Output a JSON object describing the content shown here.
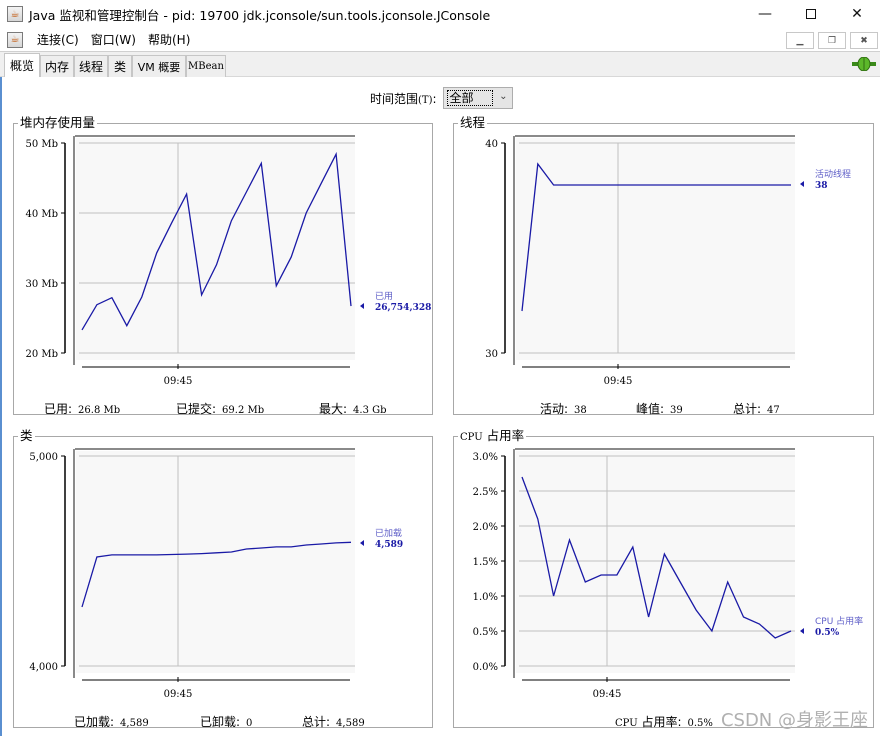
{
  "window": {
    "title": "Java 监视和管理控制台 - pid: 19700 jdk.jconsole/sun.tools.jconsole.JConsole",
    "controls": [
      "minimize",
      "maximize",
      "close"
    ]
  },
  "menubar": {
    "items": [
      {
        "label": "连接(C)"
      },
      {
        "label": "窗口(W)"
      },
      {
        "label": "帮助(H)"
      }
    ]
  },
  "tabs": [
    {
      "label": "概览",
      "active": true
    },
    {
      "label": "内存",
      "active": false
    },
    {
      "label": "线程",
      "active": false
    },
    {
      "label": "类",
      "active": false
    },
    {
      "label": "VM 概要",
      "active": false
    },
    {
      "label": "MBean",
      "active": false
    }
  ],
  "connection_icon": "plug-connected-icon",
  "time_range": {
    "label": "时间范围",
    "mnemonic": "(T)",
    "colon": ":",
    "selected": "全部"
  },
  "colors": {
    "series": "#1a1aa6",
    "grid": "#c0c0c0",
    "plot_bg": "#f8f8f8",
    "legend_label": "#6060c8"
  },
  "chart_data": [
    {
      "id": "heap",
      "type": "line",
      "title": "堆内存使用量",
      "ylabel": "Mb",
      "ylim": [
        20,
        50
      ],
      "yticks": [
        20,
        30,
        40,
        50
      ],
      "ytick_labels": [
        "20 Mb",
        "30 Mb",
        "40 Mb",
        "50 Mb"
      ],
      "xtick_labels": [
        "09:45"
      ],
      "grid": true,
      "series": [
        {
          "name": "已用",
          "values": [
            23.3,
            26.9,
            27.9,
            23.9,
            28.0,
            34.3,
            38.6,
            42.7,
            28.3,
            32.6,
            38.9,
            43.0,
            47.1,
            29.6,
            33.7,
            40.0,
            44.2,
            48.4,
            26.7
          ]
        }
      ],
      "legend": {
        "label": "已用",
        "value": "26,754,328",
        "placement": "right"
      },
      "footer": [
        {
          "label": "已用:",
          "value": "26.8  Mb"
        },
        {
          "label": "已提交:",
          "value": "69.2  Mb"
        },
        {
          "label": "最大:",
          "value": "4.3  Gb"
        }
      ]
    },
    {
      "id": "threads",
      "type": "line",
      "title": "线程",
      "ylim": [
        30,
        40
      ],
      "yticks": [
        30,
        40
      ],
      "ytick_labels": [
        "30",
        "40"
      ],
      "xtick_labels": [
        "09:45"
      ],
      "grid": true,
      "series": [
        {
          "name": "活动线程",
          "values": [
            32,
            39,
            38,
            38,
            38,
            38,
            38,
            38,
            38,
            38,
            38,
            38,
            38,
            38,
            38,
            38,
            38,
            38
          ]
        }
      ],
      "legend": {
        "label": "活动线程",
        "value": "38",
        "placement": "right"
      },
      "footer": [
        {
          "label": "活动:",
          "value": "38"
        },
        {
          "label": "峰值:",
          "value": "39"
        },
        {
          "label": "总计:",
          "value": "47"
        }
      ]
    },
    {
      "id": "classes",
      "type": "line",
      "title": "类",
      "ylim": [
        4000,
        5000
      ],
      "yticks": [
        4000,
        5000
      ],
      "ytick_labels": [
        "4,000",
        "5,000"
      ],
      "xtick_labels": [
        "09:45"
      ],
      "grid": true,
      "series": [
        {
          "name": "已加载",
          "values": [
            4281,
            4519,
            4529,
            4529,
            4529,
            4529,
            4531,
            4533,
            4535,
            4539,
            4543,
            4557,
            4562,
            4567,
            4567,
            4576,
            4581,
            4586,
            4589
          ]
        }
      ],
      "legend": {
        "label": "已加载",
        "value": "4,589",
        "placement": "right"
      },
      "footer": [
        {
          "label": "已加载:",
          "value": "4,589"
        },
        {
          "label": "已卸载:",
          "value": "0"
        },
        {
          "label": "总计:",
          "value": "4,589"
        }
      ]
    },
    {
      "id": "cpu",
      "type": "line",
      "title": "CPU 占用率",
      "ylabel": "%",
      "ylim": [
        0,
        3.0
      ],
      "yticks": [
        0,
        0.5,
        1.0,
        1.5,
        2.0,
        2.5,
        3.0
      ],
      "ytick_labels": [
        "0.0%",
        "0.5%",
        "1.0%",
        "1.5%",
        "2.0%",
        "2.5%",
        "3.0%"
      ],
      "xtick_labels": [
        "09:45"
      ],
      "grid": true,
      "series": [
        {
          "name": "CPU 占用率",
          "values": [
            2.7,
            2.1,
            1.0,
            1.8,
            1.2,
            1.3,
            1.3,
            1.7,
            0.7,
            1.6,
            1.2,
            0.8,
            0.5,
            1.2,
            0.7,
            0.6,
            0.4,
            0.5
          ]
        }
      ],
      "legend": {
        "label": "CPU 占用率",
        "value": "0.5%",
        "placement": "right"
      },
      "footer": [
        {
          "label": "CPU 占用率:",
          "value": "0.5%"
        }
      ]
    }
  ],
  "watermark": "CSDN @身影王座"
}
